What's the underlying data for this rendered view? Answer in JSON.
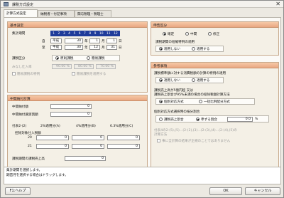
{
  "window": {
    "title": "課税方式設定"
  },
  "tabs": [
    {
      "label": "計算方式設定"
    },
    {
      "label": "納税者・付記事項"
    },
    {
      "label": "関与税理・税理士"
    }
  ],
  "basic": {
    "header": "基本設定",
    "period_label": "集計期間",
    "months": [
      "1",
      "2",
      "3",
      "4",
      "5",
      "6",
      "7",
      "8",
      "9",
      "10",
      "11",
      "12"
    ],
    "from_label": "自",
    "to_label": "至",
    "from": {
      "era": "平成",
      "year": "30",
      "year_unit": "年",
      "month": "1",
      "month_unit": "月",
      "day": "1",
      "day_unit": "日"
    },
    "to": {
      "era": "平成",
      "year": "30",
      "year_unit": "年",
      "month": "12",
      "month_unit": "月",
      "day": "31",
      "day_unit": "日"
    },
    "tax_type_label": "課税区分",
    "tax_type_options": [
      "原則課税",
      "簡易課税"
    ],
    "tax_type_selected": 0,
    "deemed_ratio_label": "みなし仕入率",
    "deemed_ratio_values": [
      "90.00 %",
      "80.00 %",
      "70.00 %"
    ],
    "special_check_label": "簡易課税の特例",
    "special_check_label2": "簡易課税を適用する"
  },
  "interim": {
    "header": "中間納付計算",
    "rows": [
      {
        "label": "中間納付額",
        "value": "0"
      },
      {
        "label": "中間納付譲渡割額",
        "value": "0"
      }
    ],
    "col_headers": [
      "2%適用分(A)",
      "4%適用分(B)",
      "6.3%適用分(C)"
    ],
    "sub_label": "付表2-(2)",
    "sub_label2": "控除対象仕入税額",
    "row_numbers": [
      "20",
      "21"
    ],
    "grid_values": [
      "0",
      "0",
      "0",
      "0",
      "0",
      "0"
    ],
    "refund_label": "課税期間の課税売上高",
    "refund_value": "0"
  },
  "filing": {
    "header": "申告区分",
    "options": [
      "確定",
      "中間",
      "修正"
    ],
    "selected": 0,
    "apply_label": "課税期間の短縮特例の適用",
    "apply_options": [
      "適用しない",
      "適用する"
    ],
    "apply_selected": 0
  },
  "ref": {
    "header": "参考事項",
    "q1": "課税標準額に対する消費税額の計算の特例の適用",
    "q1_options": [
      "適用しない",
      "適用する"
    ],
    "q1_selected": 0,
    "q2a": "課税売上高が5億円超 又は",
    "q2b": "課税売上割合が95%未満の場合の控除税額計算方法",
    "q2_options": [
      "個別対応方式",
      "一括比例配分方式"
    ],
    "q2_selected": 0,
    "q3": "個別対応方式選択時の按分割合",
    "q3_options": [
      "課税売上割合",
      "準ずる割合"
    ],
    "q3_selected": 1,
    "q3_value": "0.0",
    "q3_unit": "%",
    "note1": "付表4の2-(5),(5)…(2-(2),(3)…(2-(3),(4)…(2-(4),(5)の",
    "note2": "計算方法",
    "note_check": "事に全計算の結果が正規のことではありません"
  },
  "message": {
    "line1": "集計期間を選択します。",
    "line2": "期首月を選択する場合はドラッグします。"
  },
  "buttons": {
    "help": "F1:ヘルプ",
    "ok": "OK",
    "cancel": "キャンセル"
  }
}
